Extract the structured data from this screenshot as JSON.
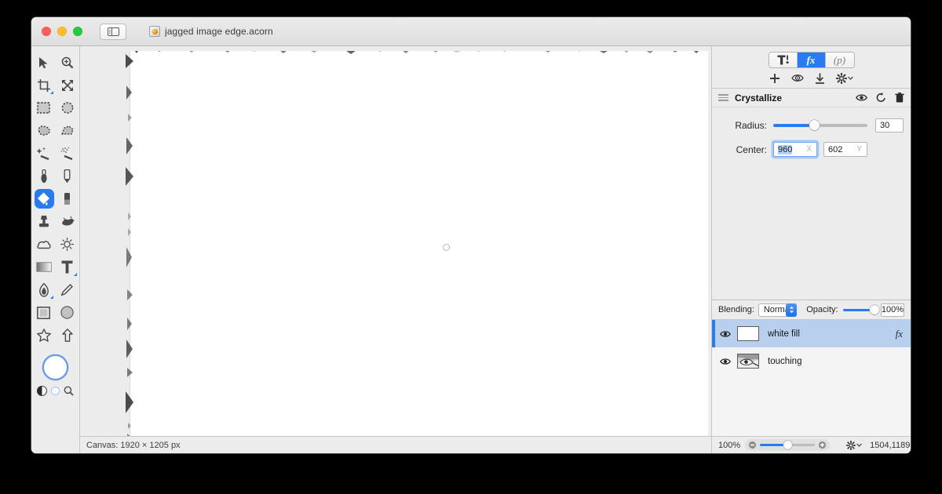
{
  "window": {
    "document_title": "jagged image edge.acorn",
    "app_icon": "acorn-app-icon",
    "traffic_lights": [
      "close-button",
      "minimize-button",
      "zoom-button"
    ],
    "sidebar_toggle_icon": "sidebar-toggle-icon"
  },
  "tools": {
    "items": [
      {
        "name": "move-tool",
        "icon": "arrow-cursor-icon",
        "active": false,
        "badge": false
      },
      {
        "name": "zoom-tool",
        "icon": "magnifier-plus-icon",
        "active": false,
        "badge": false
      },
      {
        "name": "crop-tool",
        "icon": "crop-icon",
        "active": false,
        "badge": true
      },
      {
        "name": "transform-tool",
        "icon": "move-arrows-icon",
        "active": false,
        "badge": false
      },
      {
        "name": "rectangular-select",
        "icon": "marquee-rect-icon",
        "active": false,
        "badge": false
      },
      {
        "name": "elliptical-select",
        "icon": "marquee-ellipse-icon",
        "active": false,
        "badge": false
      },
      {
        "name": "lasso-select",
        "icon": "lasso-icon",
        "active": false,
        "badge": false
      },
      {
        "name": "polygon-select",
        "icon": "polygon-lasso-icon",
        "active": false,
        "badge": false
      },
      {
        "name": "magic-wand",
        "icon": "magic-wand-icon",
        "active": false,
        "badge": false
      },
      {
        "name": "instant-alpha",
        "icon": "sparkle-wand-icon",
        "active": false,
        "badge": false
      },
      {
        "name": "brush-tool",
        "icon": "paint-brush-icon",
        "active": false,
        "badge": false
      },
      {
        "name": "pencil-tool",
        "icon": "pencil-icon",
        "active": false,
        "badge": false
      },
      {
        "name": "paint-bucket",
        "icon": "paint-bucket-icon",
        "active": true,
        "badge": false
      },
      {
        "name": "eraser-tool",
        "icon": "eraser-icon",
        "active": false,
        "badge": false
      },
      {
        "name": "clone-stamp",
        "icon": "clone-stamp-icon",
        "active": false,
        "badge": false
      },
      {
        "name": "smudge-tool",
        "icon": "smudge-icon",
        "active": false,
        "badge": false
      },
      {
        "name": "blur-tool",
        "icon": "cloud-blur-icon",
        "active": false,
        "badge": false
      },
      {
        "name": "dodge-tool",
        "icon": "sun-dodge-icon",
        "active": false,
        "badge": false
      },
      {
        "name": "gradient-tool",
        "icon": "gradient-icon",
        "active": false,
        "badge": false
      },
      {
        "name": "text-tool",
        "icon": "text-t-icon",
        "active": false,
        "badge": true
      },
      {
        "name": "bezier-pen",
        "icon": "pen-nib-icon",
        "active": false,
        "badge": true
      },
      {
        "name": "line-tool",
        "icon": "line-icon",
        "active": false,
        "badge": false
      },
      {
        "name": "rectangle-shape",
        "icon": "rectangle-icon",
        "active": false,
        "badge": false
      },
      {
        "name": "ellipse-shape",
        "icon": "ellipse-icon",
        "active": false,
        "badge": false
      },
      {
        "name": "star-shape",
        "icon": "star-icon",
        "active": false,
        "badge": false
      },
      {
        "name": "arrow-shape",
        "icon": "arrow-up-icon",
        "active": false,
        "badge": false
      }
    ],
    "color_well": {
      "name": "foreground-color-well",
      "color": "#ffffff",
      "ring": "#5b9bf4"
    },
    "extras": [
      {
        "name": "swap-colors-icon"
      },
      {
        "name": "default-colors-icon"
      },
      {
        "name": "loupe-icon"
      }
    ]
  },
  "canvas": {
    "size_label": "Canvas: 1920 × 1205 px",
    "paper_color": "#ffffff",
    "cursor": "brush-circle-cursor"
  },
  "inspector": {
    "segments": [
      {
        "name": "tool-options-tab",
        "glyph": "T!",
        "active": false
      },
      {
        "name": "filters-tab",
        "glyph": "fx",
        "active": true
      },
      {
        "name": "presets-tab",
        "glyph": "(p)",
        "active": false
      }
    ],
    "fx_toolbar": [
      {
        "name": "add-filter-button",
        "icon": "plus-icon"
      },
      {
        "name": "preview-filter-button",
        "icon": "eye-target-icon"
      },
      {
        "name": "apply-filter-button",
        "icon": "download-arrow-icon"
      },
      {
        "name": "filter-actions-menu",
        "icon": "gear-dropdown-icon"
      }
    ],
    "filter": {
      "name": "Crystallize",
      "drag_handle": "drag-handle-icon",
      "header_actions": [
        {
          "name": "filter-visibility-toggle",
          "icon": "eye-icon"
        },
        {
          "name": "filter-reset-button",
          "icon": "reset-arrow-icon"
        },
        {
          "name": "filter-delete-button",
          "icon": "trash-icon"
        }
      ],
      "controls": [
        {
          "name": "radius-control",
          "label": "Radius:",
          "type": "slider",
          "value": "30",
          "fill_percent": 44
        },
        {
          "name": "center-control",
          "label": "Center:",
          "type": "point",
          "x_value": "960",
          "y_value": "602",
          "x_axis_hint": "X",
          "y_axis_hint": "Y",
          "focused_field": "x"
        }
      ]
    }
  },
  "layers": {
    "blending_label": "Blending:",
    "blending_value": "Normal",
    "opacity_label": "Opacity:",
    "opacity_value": "100%",
    "opacity_percent": 100,
    "rows": [
      {
        "name": "layer-row-white-fill",
        "title": "white fill",
        "selected": true,
        "visible": true,
        "has_fx": true,
        "fx_glyph": "fx",
        "thumbnail": "white-fill-thumbnail"
      },
      {
        "name": "layer-row-touching",
        "title": "touching",
        "selected": false,
        "visible": true,
        "has_fx": false,
        "fx_glyph": "",
        "thumbnail": "photo-thumbnail"
      }
    ],
    "footer": [
      {
        "name": "add-layer-button",
        "icon": "plus-icon"
      },
      {
        "name": "layer-actions-menu",
        "icon": "gear-dropdown-icon"
      },
      {
        "name": "delete-layer-button",
        "icon": "trash-icon"
      }
    ]
  },
  "status": {
    "zoom_level": "100%",
    "zoom_percent": 50,
    "zoom_out_icon": "zoom-out-icon",
    "zoom_in_icon": "zoom-in-icon",
    "coordinates": "1504,1189"
  }
}
